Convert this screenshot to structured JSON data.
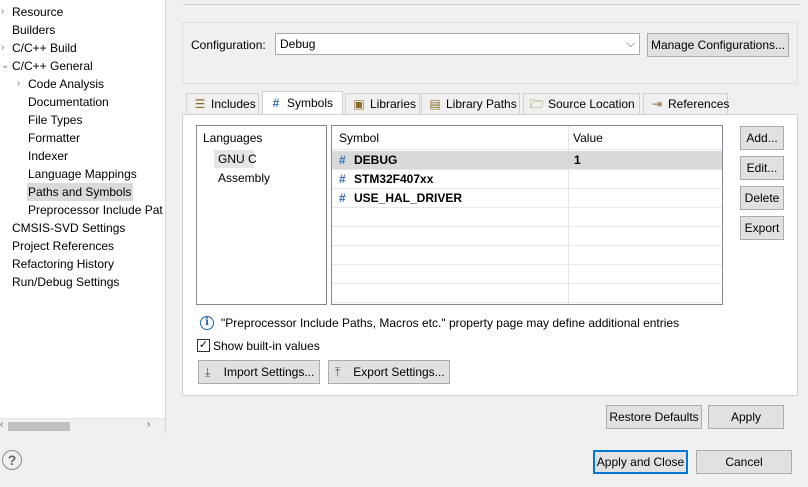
{
  "tree": {
    "items": [
      {
        "label": "Resource",
        "arrow": "›"
      },
      {
        "label": "Builders"
      },
      {
        "label": "C/C++ Build",
        "arrow": "›"
      },
      {
        "label": "C/C++ General",
        "arrow": "⌄"
      },
      {
        "label": "Code Analysis",
        "arrow": "›"
      },
      {
        "label": "Documentation"
      },
      {
        "label": "File Types"
      },
      {
        "label": "Formatter"
      },
      {
        "label": "Indexer"
      },
      {
        "label": "Language Mappings"
      },
      {
        "label": "Paths and Symbols"
      },
      {
        "label": "Preprocessor Include Pat"
      },
      {
        "label": "CMSIS-SVD Settings"
      },
      {
        "label": "Project References"
      },
      {
        "label": "Refactoring History"
      },
      {
        "label": "Run/Debug Settings"
      }
    ],
    "scroll_left": "‹",
    "scroll_right": "›"
  },
  "config": {
    "label": "Configuration:",
    "value": "Debug",
    "manage_button": "Manage Configurations..."
  },
  "tabs": [
    {
      "label": "Includes",
      "icon": "includes-icon"
    },
    {
      "label": "Symbols",
      "icon": "hash-icon",
      "glyph": "#"
    },
    {
      "label": "Libraries",
      "icon": "libraries-icon"
    },
    {
      "label": "Library Paths",
      "icon": "library-paths-icon"
    },
    {
      "label": "Source Location",
      "icon": "source-folder-icon"
    },
    {
      "label": "References",
      "icon": "references-icon"
    }
  ],
  "languages": {
    "header": "Languages",
    "items": [
      "GNU C",
      "Assembly"
    ]
  },
  "table": {
    "columns": [
      "Symbol",
      "Value"
    ],
    "rows": [
      {
        "symbol": "DEBUG",
        "value": "1"
      },
      {
        "symbol": "STM32F407xx",
        "value": ""
      },
      {
        "symbol": "USE_HAL_DRIVER",
        "value": ""
      }
    ]
  },
  "side_buttons": {
    "add": "Add...",
    "edit": "Edit...",
    "delete": "Delete",
    "export": "Export"
  },
  "info_text": "\"Preprocessor Include Paths, Macros etc.\" property page may define additional entries",
  "show_builtin": {
    "label": "Show built-in values",
    "checked": true,
    "glyph": "✓"
  },
  "import_button": "Import Settings...",
  "export_button": "Export Settings...",
  "restore_defaults": "Restore Defaults",
  "apply": "Apply",
  "apply_and_close": "Apply and Close",
  "cancel": "Cancel",
  "help_glyph": "?",
  "colors": {
    "accent": "#0078d7",
    "selection": "#dadada",
    "hash_icon": "#2e6fb5"
  }
}
